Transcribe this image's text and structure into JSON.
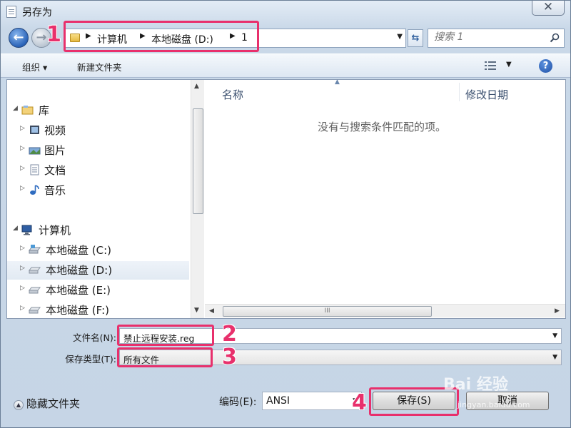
{
  "window": {
    "title": "另存为",
    "close_label": "✕"
  },
  "nav": {
    "back_glyph": "←",
    "forward_glyph": "→",
    "breadcrumb": [
      "计算机",
      "本地磁盘 (D:)",
      "1"
    ],
    "refresh_glyph": "⇆",
    "search_placeholder": "搜索 1"
  },
  "toolbar": {
    "organize_label": "组织 ▾",
    "new_folder_label": "新建文件夹",
    "help_glyph": "?"
  },
  "tree": {
    "libraries": "库",
    "library_items": [
      "视频",
      "图片",
      "文档",
      "音乐"
    ],
    "computer": "计算机",
    "drives": [
      "本地磁盘 (C:)",
      "本地磁盘 (D:)",
      "本地磁盘 (E:)",
      "本地磁盘 (F:)"
    ],
    "selected_drive": "本地磁盘 (D:)"
  },
  "file_list": {
    "columns": [
      "名称",
      "修改日期"
    ],
    "empty_message": "没有与搜索条件匹配的项。",
    "scroll_grip": "III"
  },
  "form": {
    "filename_label": "文件名(N):",
    "filename_value": "禁止远程安装.reg",
    "filetype_label": "保存类型(T):",
    "filetype_value": "所有文件"
  },
  "bottom": {
    "hide_folders_label": "隐藏文件夹",
    "encoding_label": "编码(E):",
    "encoding_value": "ANSI",
    "save_label": "保存(S)",
    "cancel_label": "取消"
  },
  "callouts": [
    "1",
    "2",
    "3",
    "4"
  ],
  "watermark": {
    "text": "Bai 经验",
    "sub": "jingyan.baidu.com"
  },
  "colors": {
    "callout": "#e8306c",
    "selection": "#e2eaf3",
    "window_frame": "#c6d5e6"
  }
}
